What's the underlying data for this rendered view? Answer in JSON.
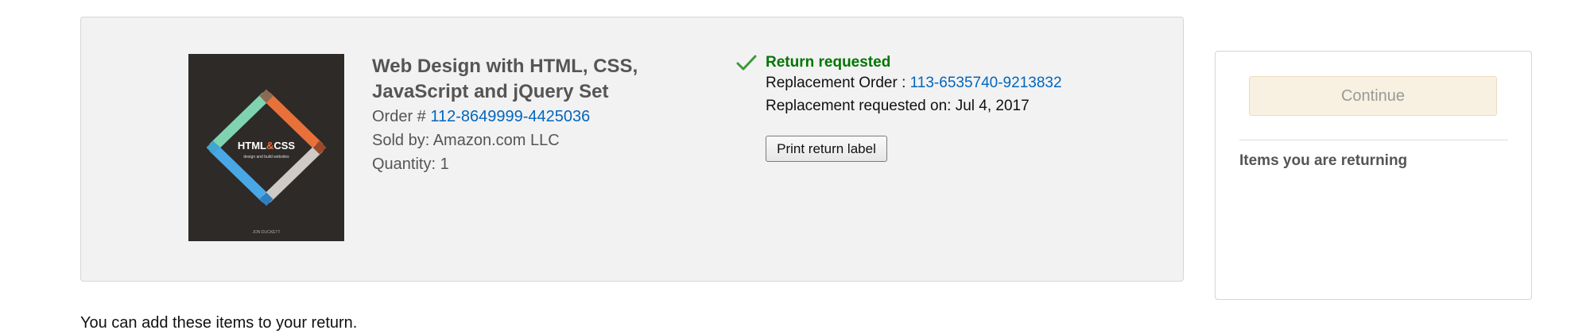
{
  "item": {
    "title": "Web Design with HTML, CSS, JavaScript and jQuery Set",
    "order_prefix": "Order # ",
    "order_number": "112-8649999-4425036",
    "sold_by": "Sold by: Amazon.com LLC",
    "quantity": "Quantity: 1",
    "cover": {
      "title_left": "HTML",
      "title_amp": "&",
      "title_right": "CSS",
      "subtitle": "design and build websites",
      "author": "JON DUCKETT"
    }
  },
  "return_info": {
    "status": "Return requested",
    "status_icon": "checkmark-icon",
    "replacement_prefix": "Replacement Order : ",
    "replacement_order": "113-6535740-9213832",
    "requested_on": "Replacement requested on: Jul 4, 2017",
    "print_label_button": "Print return label"
  },
  "side_panel": {
    "continue_button": "Continue",
    "items_heading": "Items you are returning"
  },
  "footer": {
    "add_items_text": "You can add these items to your return."
  },
  "colors": {
    "panel_bg": "#f2f2f2",
    "link": "#0066c0",
    "success": "#007600",
    "continue_bg": "#f8f0e0"
  }
}
